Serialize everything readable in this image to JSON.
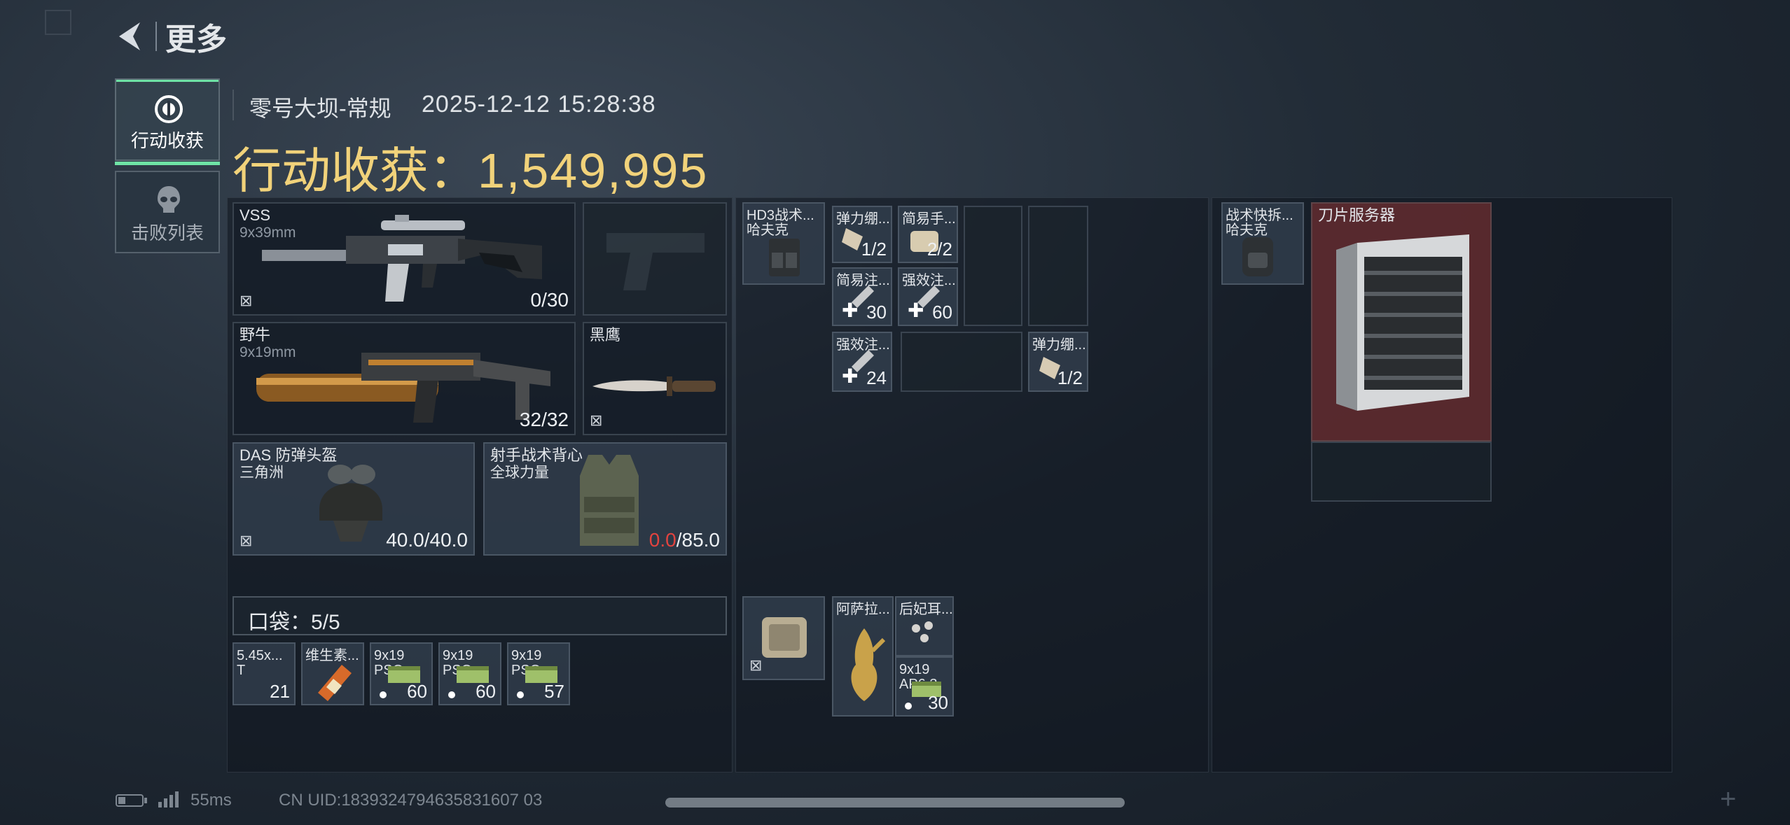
{
  "header": {
    "back_label": "更多"
  },
  "side_tabs": [
    {
      "label": "行动收获",
      "icon": "target-emblem-icon"
    },
    {
      "label": "击败列表",
      "icon": "skull-icon"
    }
  ],
  "match": {
    "map_mode": "零号大坝-常规",
    "datetime": "2025-12-12 15:28:38",
    "earnings_label": "行动收获：",
    "earnings_value": "1,549,995"
  },
  "loadout": {
    "primary": {
      "name": "VSS",
      "caliber": "9x39mm",
      "ammo": "0/30"
    },
    "secondary": {
      "name": "野牛",
      "caliber": "9x19mm",
      "ammo": "32/32"
    },
    "melee": {
      "name": "黑鹰"
    },
    "helmet": {
      "name": "DAS 防弹头盔",
      "brand": "三角洲",
      "durability": "40.0/40.0"
    },
    "armor": {
      "name": "射手战术背心",
      "brand": "全球力量",
      "durability_current": "0.0",
      "durability_max": "/85.0"
    }
  },
  "pockets": {
    "label": "口袋：5/5",
    "items": [
      {
        "name": "5.45x...",
        "sub": "T",
        "count": "21"
      },
      {
        "name": "维生素...",
        "sub": "",
        "count": ""
      },
      {
        "name": "9x19",
        "sub": "PSO",
        "count": "60"
      },
      {
        "name": "9x19",
        "sub": "PSO",
        "count": "60"
      },
      {
        "name": "9x19",
        "sub": "PSO",
        "count": "57"
      }
    ]
  },
  "rig": {
    "name": "HD3战术...",
    "brand": "哈夫克",
    "slots": [
      {
        "name": "弹力绷...",
        "count": "1/2"
      },
      {
        "name": "简易手...",
        "count": "2/2"
      },
      {
        "name": "简易注...",
        "count": "30"
      },
      {
        "name": "强效注...",
        "count": "60"
      },
      {
        "name": "强效注...",
        "count": "24"
      },
      {
        "name": "弹力绷...",
        "count": "1/2"
      }
    ]
  },
  "safe_box": {
    "items": [
      {
        "name": "阿萨拉..."
      },
      {
        "name": "后妃耳..."
      },
      {
        "name": "9x19",
        "sub": "AP6.3",
        "count": "30"
      }
    ]
  },
  "backpack": {
    "name": "战术快拆...",
    "brand": "哈夫克",
    "items": [
      {
        "name": "刀片服务器"
      }
    ]
  },
  "status_bar": {
    "ping": "55ms",
    "uid": "CN UID:1839324794635831607 03"
  },
  "colors": {
    "gold": "#f1d27a",
    "red": "#e2433f",
    "accent_green": "#6fe3a6"
  }
}
